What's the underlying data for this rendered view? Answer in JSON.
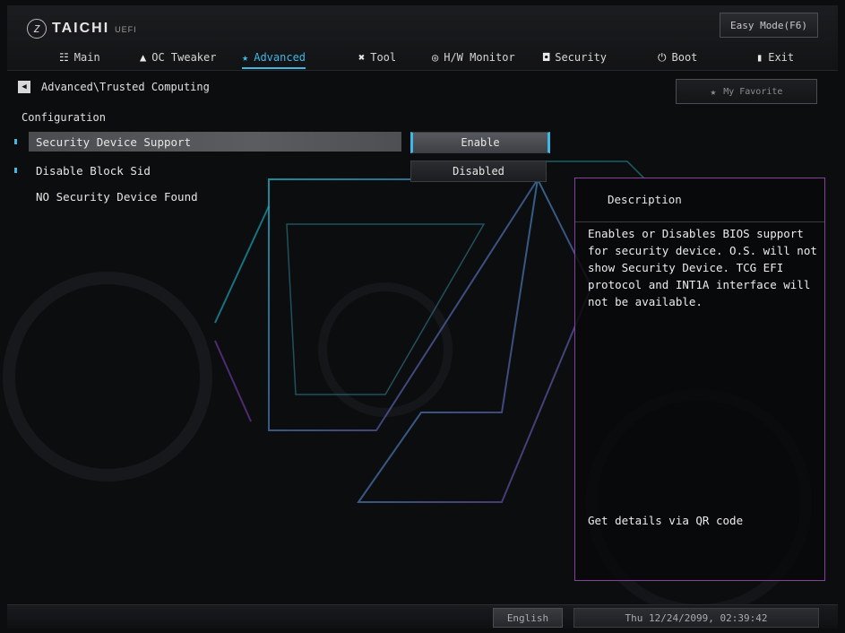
{
  "brand": {
    "name": "TAICHI",
    "sub": "UEFI"
  },
  "easy_mode_label": "Easy Mode(F6)",
  "nav": [
    {
      "label": "Main",
      "icon": "grid-icon"
    },
    {
      "label": "OC Tweaker",
      "icon": "rocket-icon"
    },
    {
      "label": "Advanced",
      "icon": "star-icon",
      "active": true
    },
    {
      "label": "Tool",
      "icon": "tools-icon"
    },
    {
      "label": "H/W Monitor",
      "icon": "gauge-icon"
    },
    {
      "label": "Security",
      "icon": "shield-icon"
    },
    {
      "label": "Boot",
      "icon": "power-icon"
    },
    {
      "label": "Exit",
      "icon": "door-icon"
    }
  ],
  "breadcrumb": "Advanced\\Trusted Computing",
  "favorite_label": "My Favorite",
  "section_title": "Configuration",
  "settings": [
    {
      "label": "Security Device Support",
      "value": "Enable",
      "selected": true
    },
    {
      "label": "Disable Block Sid",
      "value": "Disabled",
      "selected": false
    }
  ],
  "info_text": "NO Security Device Found",
  "description": {
    "title": "Description",
    "body": "Enables or Disables BIOS support for security device. O.S. will not show Security Device. TCG EFI protocol and INT1A interface will not be available.",
    "qr": "Get details via QR code"
  },
  "footer": {
    "language": "English",
    "datetime": "Thu 12/24/2099, 02:39:42"
  },
  "colors": {
    "accent": "#3fb8e6",
    "panel_border": "#8a3fa0"
  }
}
